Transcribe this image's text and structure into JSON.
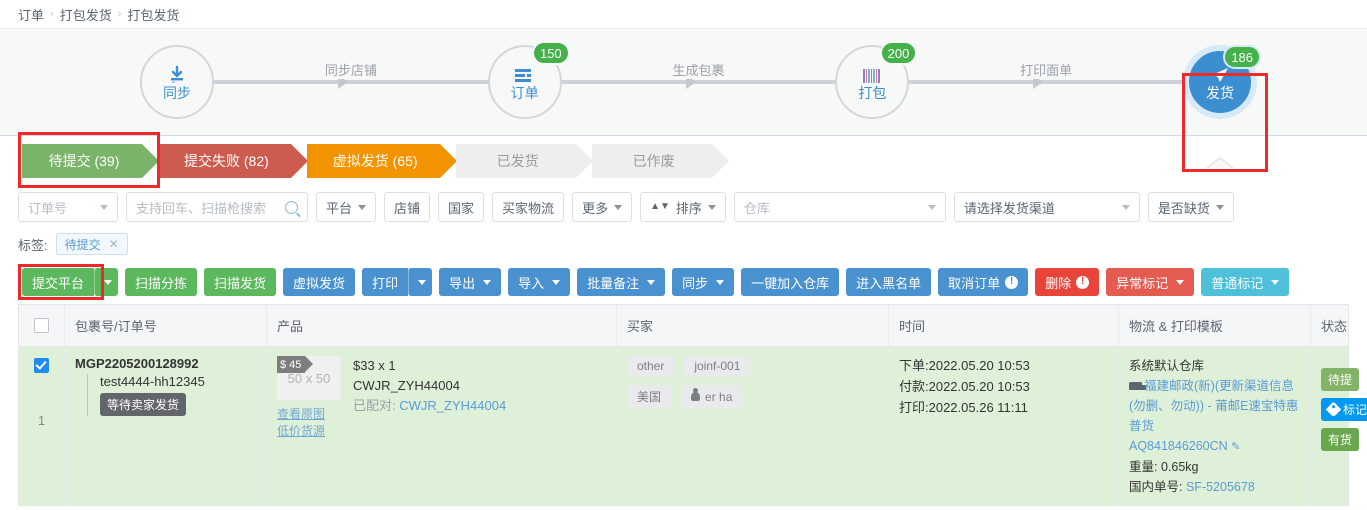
{
  "breadcrumb": {
    "items": [
      "订单",
      "打包发货",
      "打包发货"
    ],
    "separator": "›"
  },
  "steps": {
    "nodes": [
      {
        "label": "同步",
        "badge": "",
        "icon": "download-icon"
      },
      {
        "label": "订单",
        "badge": "150",
        "icon": "list-icon"
      },
      {
        "label": "打包",
        "badge": "200",
        "icon": "barcode-icon"
      },
      {
        "label": "发货",
        "badge": "186",
        "icon": "send-icon"
      }
    ],
    "connectors": [
      "同步店铺",
      "生成包裹",
      "打印面单"
    ]
  },
  "tabs": [
    {
      "label": "待提交 (39)",
      "state": "green",
      "selected": true
    },
    {
      "label": "提交失败 (82)",
      "state": "red",
      "selected": false
    },
    {
      "label": "虚拟发货 (65)",
      "state": "orange",
      "selected": false
    },
    {
      "label": "已发货",
      "state": "grey",
      "selected": false
    },
    {
      "label": "已作废",
      "state": "grey",
      "selected": false
    }
  ],
  "filters": {
    "order_field": "订单号",
    "search_placeholder": "支持回车、扫描枪搜索",
    "platform": "平台",
    "shop": "店铺",
    "country": "国家",
    "buyer_logistics": "买家物流",
    "more": "更多",
    "sort": "排序",
    "warehouse": "仓库",
    "channel": "请选择发货渠道",
    "stock": "是否缺货"
  },
  "tagbar": {
    "label": "标签:",
    "chip": "待提交",
    "chip_close": "✕"
  },
  "actions": [
    {
      "label": "提交平台",
      "color": "green",
      "split": true,
      "caret": false,
      "warn": false
    },
    {
      "label": "扫描分拣",
      "color": "green",
      "split": false,
      "caret": false,
      "warn": false
    },
    {
      "label": "扫描发货",
      "color": "green",
      "split": false,
      "caret": false,
      "warn": false
    },
    {
      "label": "虚拟发货",
      "color": "blue",
      "split": false,
      "caret": false,
      "warn": false
    },
    {
      "label": "打印",
      "color": "blue",
      "split": true,
      "caret": false,
      "warn": false
    },
    {
      "label": "导出",
      "color": "blue",
      "split": false,
      "caret": true,
      "warn": false
    },
    {
      "label": "导入",
      "color": "blue",
      "split": false,
      "caret": true,
      "warn": false
    },
    {
      "label": "批量备注",
      "color": "blue",
      "split": false,
      "caret": true,
      "warn": false
    },
    {
      "label": "同步",
      "color": "blue",
      "split": false,
      "caret": true,
      "warn": false
    },
    {
      "label": "一键加入仓库",
      "color": "blue",
      "split": false,
      "caret": false,
      "warn": false
    },
    {
      "label": "进入黑名单",
      "color": "blue",
      "split": false,
      "caret": false,
      "warn": false
    },
    {
      "label": "取消订单",
      "color": "blue",
      "split": false,
      "caret": false,
      "warn": true
    },
    {
      "label": "删除",
      "color": "red",
      "split": false,
      "caret": false,
      "warn": true
    },
    {
      "label": "异常标记",
      "color": "red2",
      "split": false,
      "caret": true,
      "warn": false
    },
    {
      "label": "普通标记",
      "color": "cyan",
      "split": false,
      "caret": true,
      "warn": false
    }
  ],
  "table": {
    "headers": [
      "",
      "包裹号/订单号",
      "产品",
      "买家",
      "时间",
      "物流 & 打印模板",
      "状态"
    ],
    "row": {
      "index": "1",
      "checked": true,
      "package_no": "MGP2205200128992",
      "sub_order": "test4444-hh12345",
      "wait_badge": "等待卖家发货",
      "product": {
        "price_tag": "$ 45",
        "thumb_size": "50 x 50",
        "view_original": "查看原图",
        "cheap_source": "低价货源",
        "price_qty": "$33 x 1",
        "sku": "CWJR_ZYH44004",
        "matched_label": "已配对:",
        "matched_sku": "CWJR_ZYH44004"
      },
      "buyer": {
        "tags": [
          "other",
          "joinf-001",
          "美国"
        ],
        "name": "er ha"
      },
      "time": [
        "下单:2022.05.20 10:53",
        "付款:2022.05.20 10:53",
        "打印:2022.05.26 11:11"
      ],
      "logistics": {
        "warehouse": "系统默认仓库",
        "channel": "福建邮政(新)(更新渠道信息(勿删、勿动)) - 莆邮E速宝特惠普货",
        "tracking_no": "AQ841846260CN",
        "weight_label": "重量:",
        "weight": "0.65kg",
        "domestic_label": "国内单号:",
        "domestic_no": "SF-5205678"
      },
      "status_pills": [
        "待提",
        "标记",
        "有货"
      ]
    }
  },
  "highlights": {
    "color": "#ef2929"
  }
}
